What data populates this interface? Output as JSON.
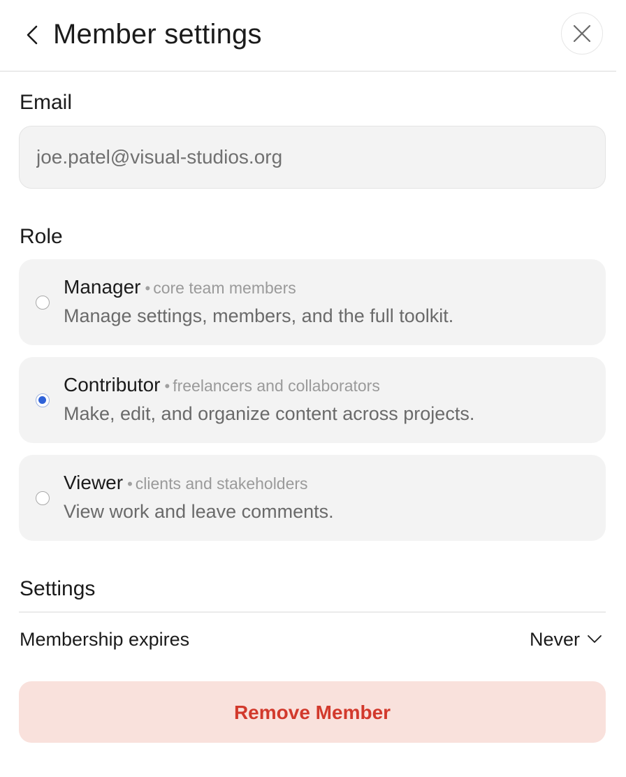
{
  "header": {
    "title": "Member settings"
  },
  "email": {
    "label": "Email",
    "value": "joe.patel@visual-studios.org"
  },
  "role": {
    "label": "Role",
    "options": [
      {
        "name": "Manager",
        "tag": "core team members",
        "description": "Manage settings, members, and the full toolkit.",
        "selected": false
      },
      {
        "name": "Contributor",
        "tag": "freelancers and collaborators",
        "description": "Make, edit, and organize content across projects.",
        "selected": true
      },
      {
        "name": "Viewer",
        "tag": "clients and stakeholders",
        "description": "View work and leave comments.",
        "selected": false
      }
    ]
  },
  "settings": {
    "label": "Settings",
    "expires_label": "Membership expires",
    "expires_value": "Never"
  },
  "actions": {
    "remove_label": "Remove Member"
  },
  "colors": {
    "accent": "#2f62d8",
    "danger_text": "#d2392c",
    "danger_bg": "#f9e1dc",
    "card_bg": "#f3f3f3"
  },
  "icons": {
    "back": "chevron-left-icon",
    "close": "close-icon",
    "dropdown": "chevron-down-icon",
    "separator": "bullet-dot"
  }
}
